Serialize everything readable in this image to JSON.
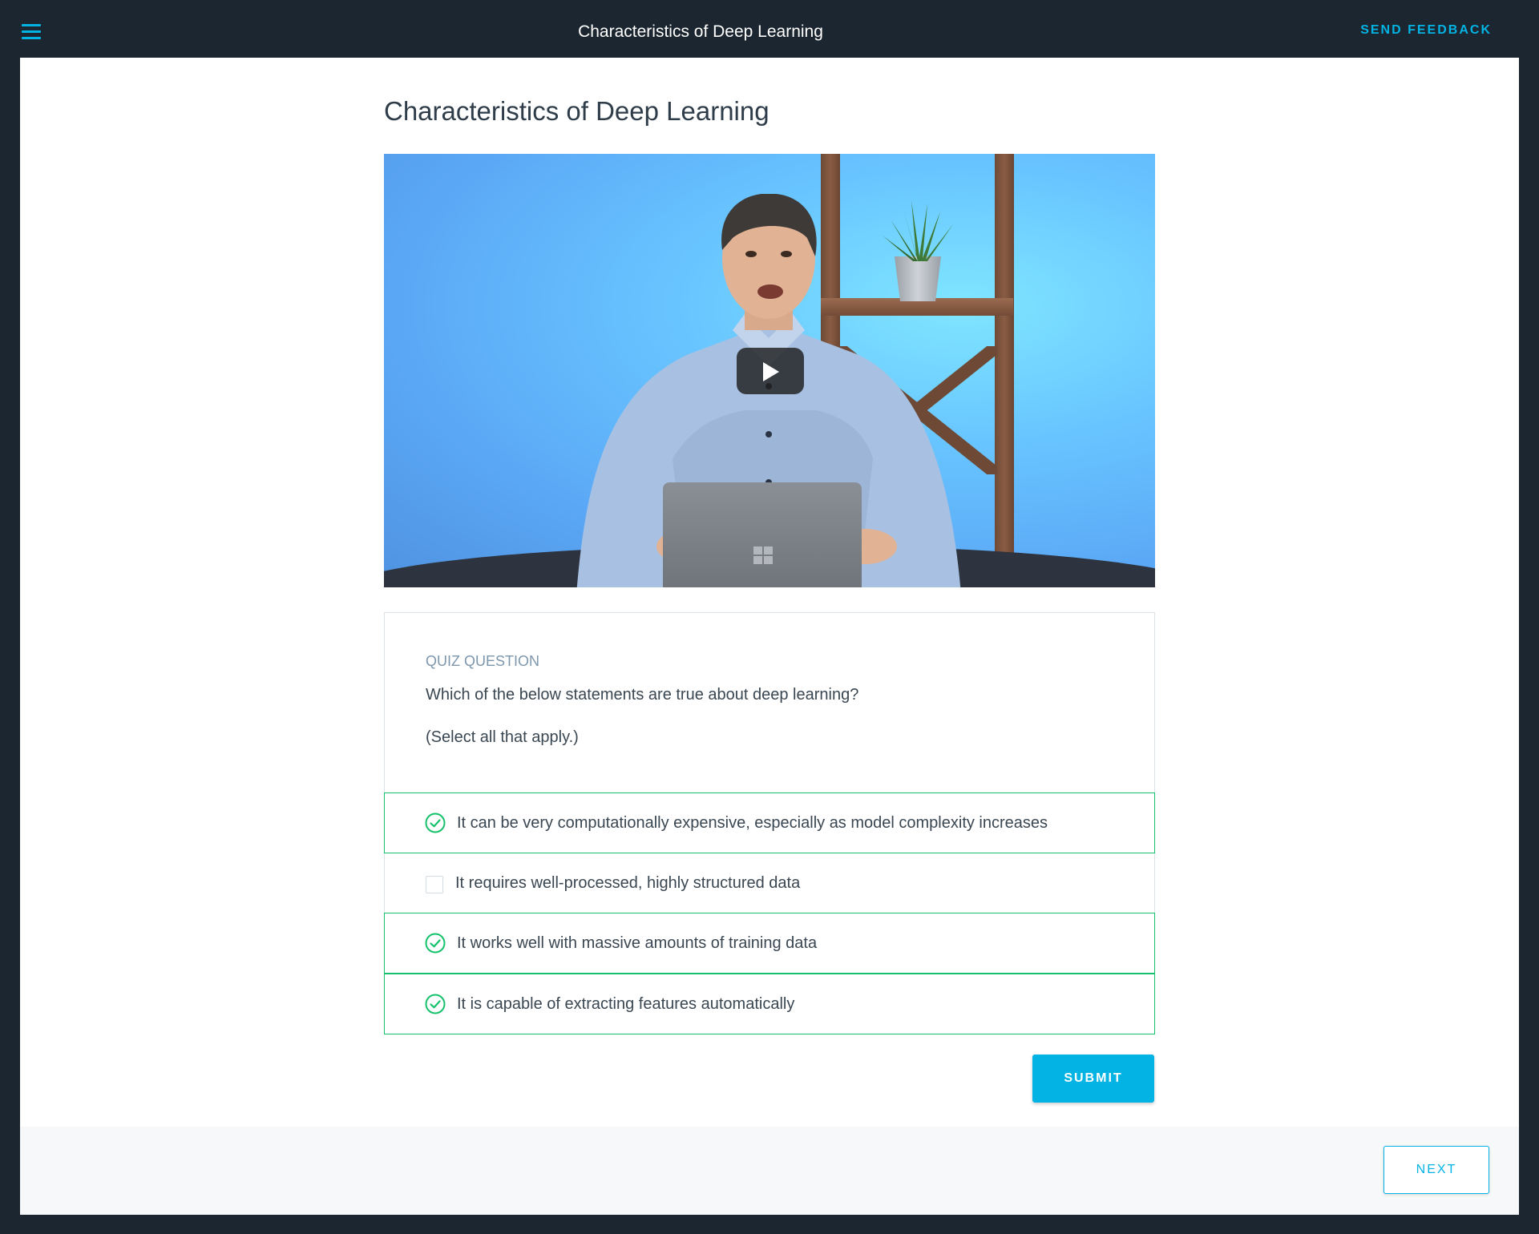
{
  "header": {
    "menu_icon": "hamburger-menu-icon",
    "title": "Characteristics of Deep Learning",
    "feedback_label": "SEND FEEDBACK"
  },
  "lesson": {
    "title": "Characteristics of Deep Learning"
  },
  "video": {
    "play_icon": "play-icon"
  },
  "quiz": {
    "label": "QUIZ QUESTION",
    "question": "Which of the below statements are true about deep learning?",
    "hint": "(Select all that apply.)",
    "options": [
      {
        "text": "It can be very computationally expensive, especially as model complexity increases",
        "checked": true
      },
      {
        "text": "It requires well-processed, highly structured data",
        "checked": false
      },
      {
        "text": "It works well with massive amounts of training data",
        "checked": true
      },
      {
        "text": "It is capable of extracting features automatically",
        "checked": true
      }
    ],
    "submit_label": "SUBMIT"
  },
  "footer": {
    "next_label": "NEXT"
  },
  "colors": {
    "accent": "#02b3e4",
    "success": "#15c26b",
    "header_bg": "#1c2630"
  }
}
